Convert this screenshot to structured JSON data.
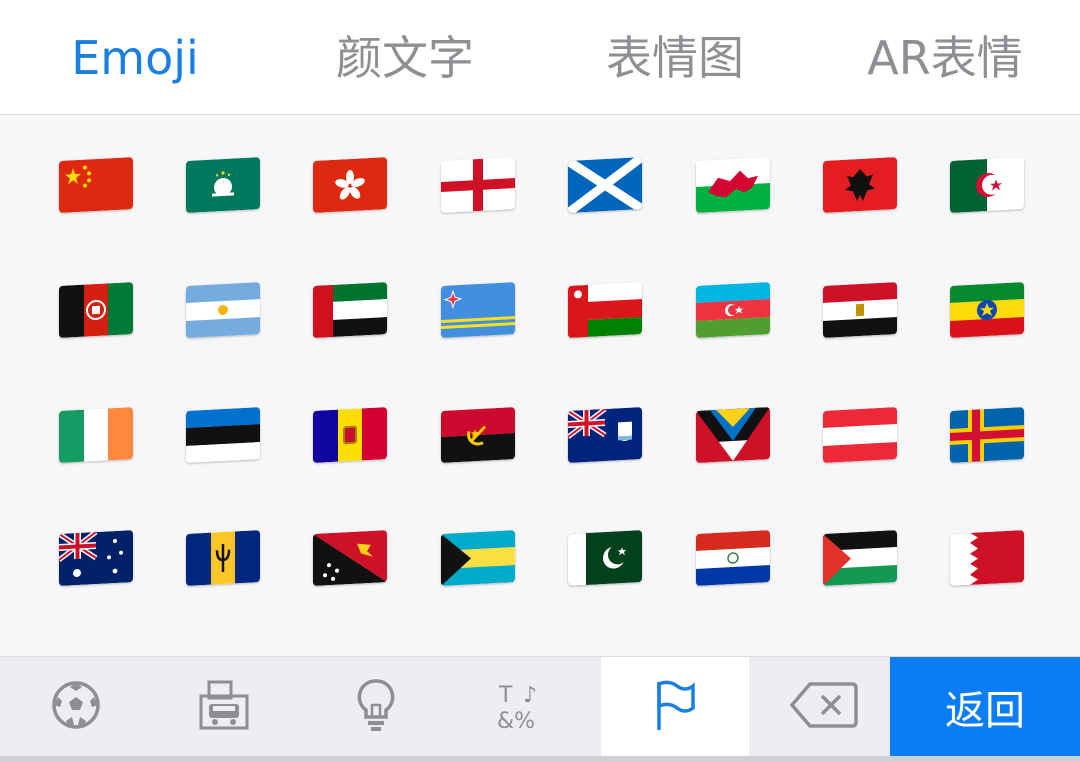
{
  "tabs": [
    {
      "label": "Emoji",
      "active": true
    },
    {
      "label": "颜文字",
      "active": false
    },
    {
      "label": "表情图",
      "active": false
    },
    {
      "label": "AR表情",
      "active": false
    }
  ],
  "flags": [
    "china-flag",
    "macau-flag",
    "hong-kong-flag",
    "england-flag",
    "scotland-flag",
    "wales-flag",
    "albania-flag",
    "algeria-flag",
    "afghanistan-flag",
    "argentina-flag",
    "uae-flag",
    "aruba-flag",
    "oman-flag",
    "azerbaijan-flag",
    "egypt-flag",
    "ethiopia-flag",
    "ireland-flag",
    "estonia-flag",
    "andorra-flag",
    "angola-flag",
    "anguilla-flag",
    "antigua-barbuda-flag",
    "austria-flag",
    "aland-islands-flag",
    "australia-flag",
    "barbados-flag",
    "papua-new-guinea-flag",
    "bahamas-flag",
    "pakistan-flag",
    "paraguay-flag",
    "palestine-flag",
    "bahrain-flag"
  ],
  "bottom_bar": {
    "categories": [
      "soccer-ball-icon",
      "buildings-car-icon",
      "lightbulb-icon",
      "symbols-icon",
      "flag-icon"
    ],
    "selected": "flag-icon",
    "delete": "backspace-icon",
    "return_label": "返回"
  },
  "colors": {
    "accent": "#1a7fe0",
    "return_bg": "#0a7cf4"
  }
}
